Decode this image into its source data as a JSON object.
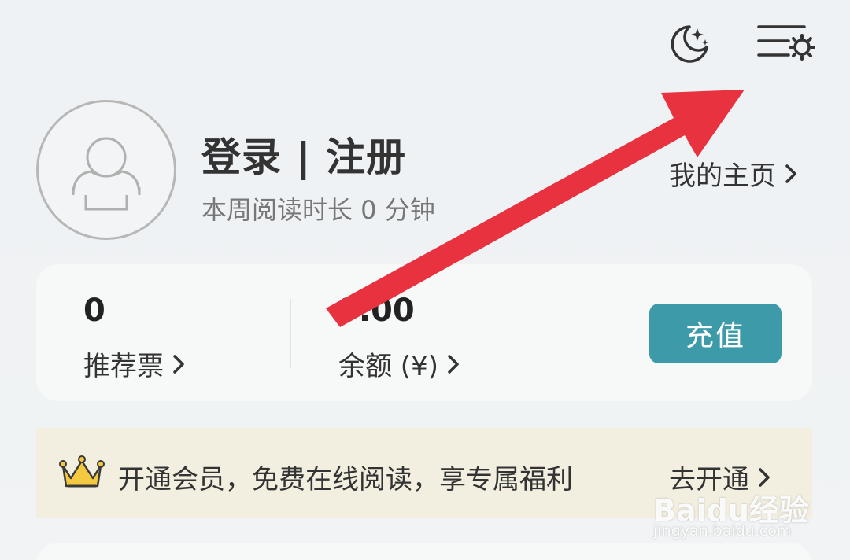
{
  "header": {
    "night_mode_icon": "moon-stars-icon",
    "settings_icon": "menu-settings-icon"
  },
  "profile": {
    "avatar_icon": "default-user-avatar",
    "login_label": "登录 | 注册",
    "reading_time": "本周阅读时长 0 分钟",
    "homepage_label": "我的主页"
  },
  "wallet": {
    "ticket_count": "0",
    "ticket_label": "推荐票",
    "balance_amount": "0.00",
    "balance_label": "余额 (¥)",
    "recharge_label": "充值",
    "accent_color": "#3d9aa8"
  },
  "vip": {
    "icon": "crown-icon",
    "text": "开通会员，免费在线阅读，享专属福利",
    "cta_label": "去开通"
  },
  "watermark": {
    "brand": "Baidu经验",
    "url": "jingyan.baidu.com"
  },
  "annotation": {
    "arrow_color": "#e8323f"
  }
}
